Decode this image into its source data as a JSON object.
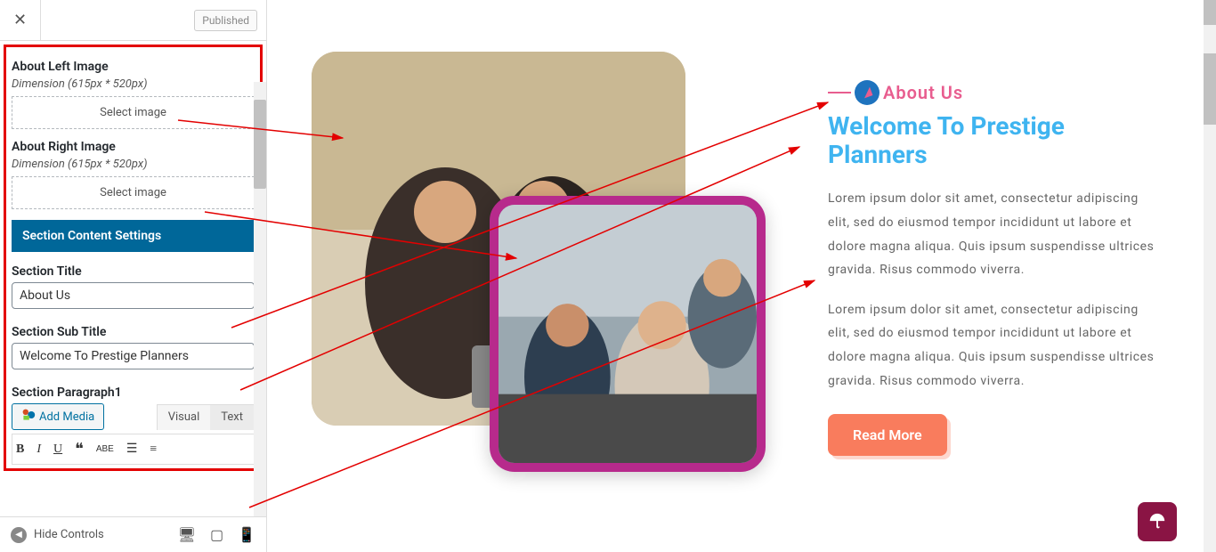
{
  "header": {
    "published_label": "Published"
  },
  "sidebar": {
    "about_left_label": "About Left Image",
    "about_left_dim": "Dimension (615px * 520px)",
    "about_right_label": "About Right Image",
    "about_right_dim": "Dimension (615px * 520px)",
    "select_image_label": "Select image",
    "content_settings_heading": "Section Content Settings",
    "section_title_label": "Section Title",
    "section_title_value": "About Us",
    "section_subtitle_label": "Section Sub Title",
    "section_subtitle_value": "Welcome To Prestige Planners",
    "section_para1_label": "Section Paragraph1",
    "add_media_label": "Add Media",
    "tab_visual": "Visual",
    "tab_text": "Text"
  },
  "footer": {
    "hide_controls_label": "Hide Controls"
  },
  "preview": {
    "eyebrow": "About Us",
    "subtitle": "Welcome To Prestige Planners",
    "para1": "Lorem ipsum dolor sit amet, consectetur adipiscing elit, sed do eiusmod tempor incididunt ut labore et dolore magna aliqua. Quis ipsum suspendisse ultrices gravida. Risus commodo viverra.",
    "para2": "Lorem ipsum dolor sit amet, consectetur adipiscing elit, sed do eiusmod tempor incididunt ut labore et dolore magna aliqua. Quis ipsum suspendisse ultrices gravida. Risus commodo viverra.",
    "read_more": "Read More"
  },
  "colors": {
    "accent_pink": "#e85d8f",
    "accent_blue": "#3fb4f0",
    "button_coral": "#f97c5d",
    "frame_magenta": "#b72a8c",
    "heading_blue": "#006799",
    "annotation_red": "#e30000",
    "scrolltop_bg": "#8a1444"
  }
}
